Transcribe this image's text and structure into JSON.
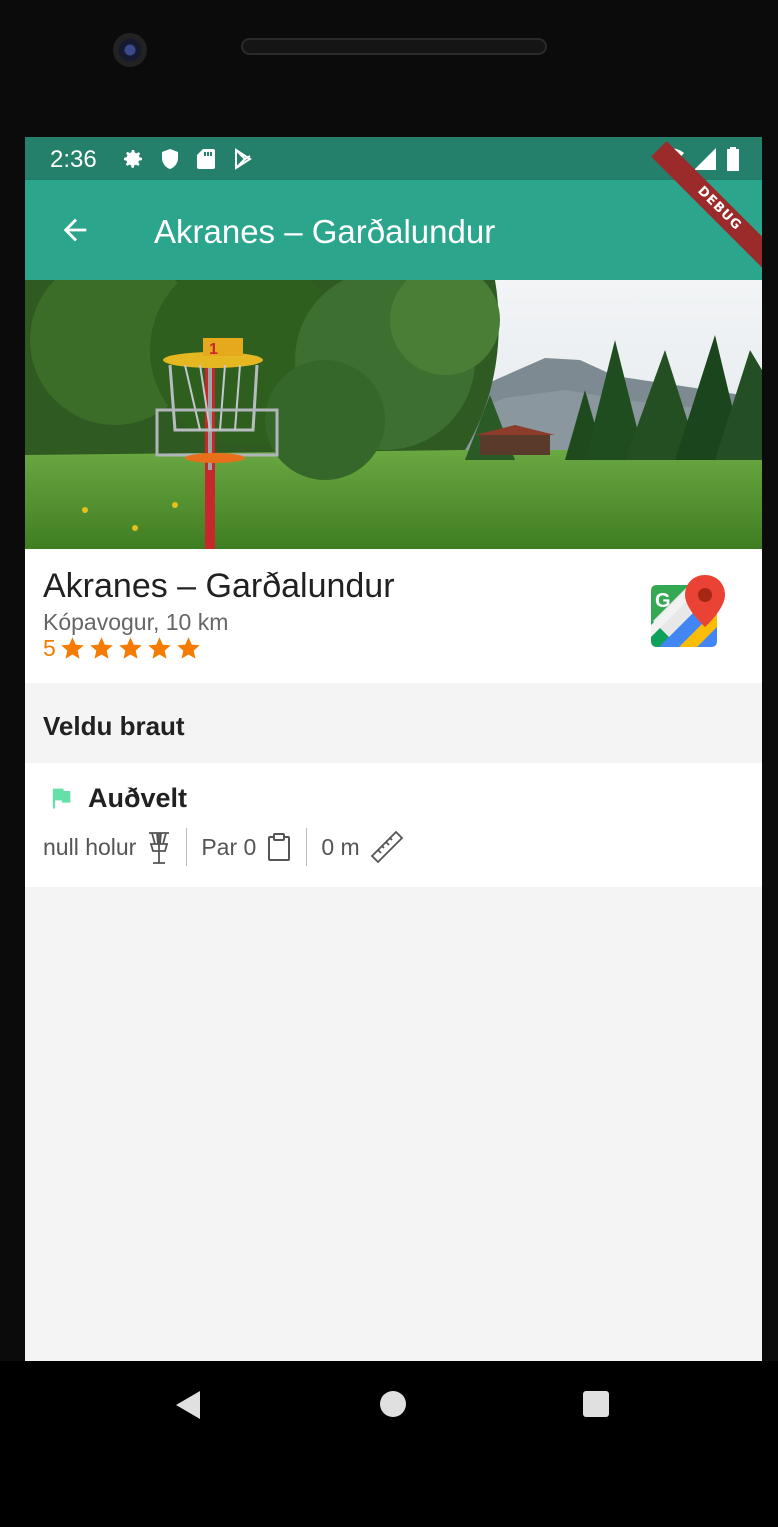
{
  "status_bar": {
    "time": "2:36",
    "icons": [
      "gear-icon",
      "shield-icon",
      "sd-card-icon",
      "play-store-icon"
    ],
    "right_icons": [
      "wifi-icon",
      "signal-icon",
      "battery-icon"
    ]
  },
  "app_bar": {
    "title": "Akranes – Garðalundur",
    "back_icon": "arrow-back-icon",
    "debug_label": "DEBUG"
  },
  "course": {
    "name": "Akranes – Garðalundur",
    "location": "Kópavogur, 10 km",
    "rating_value": "5",
    "stars": 5,
    "maps_icon": "google-maps-icon"
  },
  "section": {
    "title": "Veldu braut"
  },
  "tracks": [
    {
      "name": "Auðvelt",
      "flag_color": "#66e0a8",
      "holes": "null holur",
      "par": "Par 0",
      "length": "0 m"
    }
  ],
  "colors": {
    "status_bar": "#24806b",
    "app_bar": "#2ca58d",
    "star": "#f57c00",
    "debug_ribbon": "#9b2b2b"
  }
}
